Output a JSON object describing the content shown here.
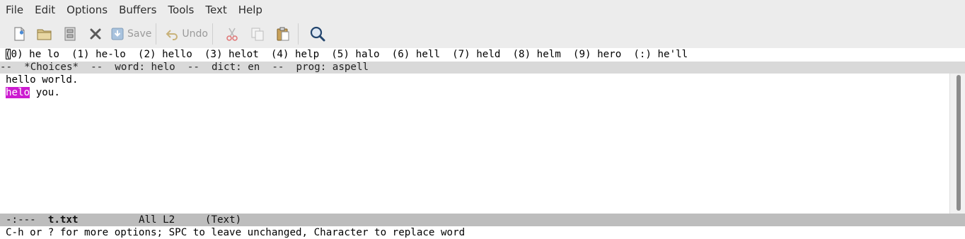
{
  "menubar": {
    "items": [
      "File",
      "Edit",
      "Options",
      "Buffers",
      "Tools",
      "Text",
      "Help"
    ]
  },
  "toolbar": {
    "save_label": "Save",
    "undo_label": "Undo"
  },
  "choices_line": "(0) he lo  (1) he-lo  (2) hello  (3) helot  (4) help  (5) halo  (6) hell  (7) held  (8) helm  (9) hero  (:) he'll",
  "choices_modeline": "--  *Choices*  --  word: helo  --  dict: en  --  prog: aspell",
  "buffer": {
    "line1": "hello world.",
    "line2_word": "helo",
    "line2_rest": " you."
  },
  "modeline": {
    "status": "-:---",
    "filename": "t.txt",
    "position": "All L2",
    "mode": "(Text)"
  },
  "echo_area": "C-h or ? for more options; SPC to leave unchanged, Character to replace word",
  "colors": {
    "highlight": "#cc1bd0",
    "menubar_bg": "#ececec",
    "modeline_bg": "#bdbdbd"
  }
}
